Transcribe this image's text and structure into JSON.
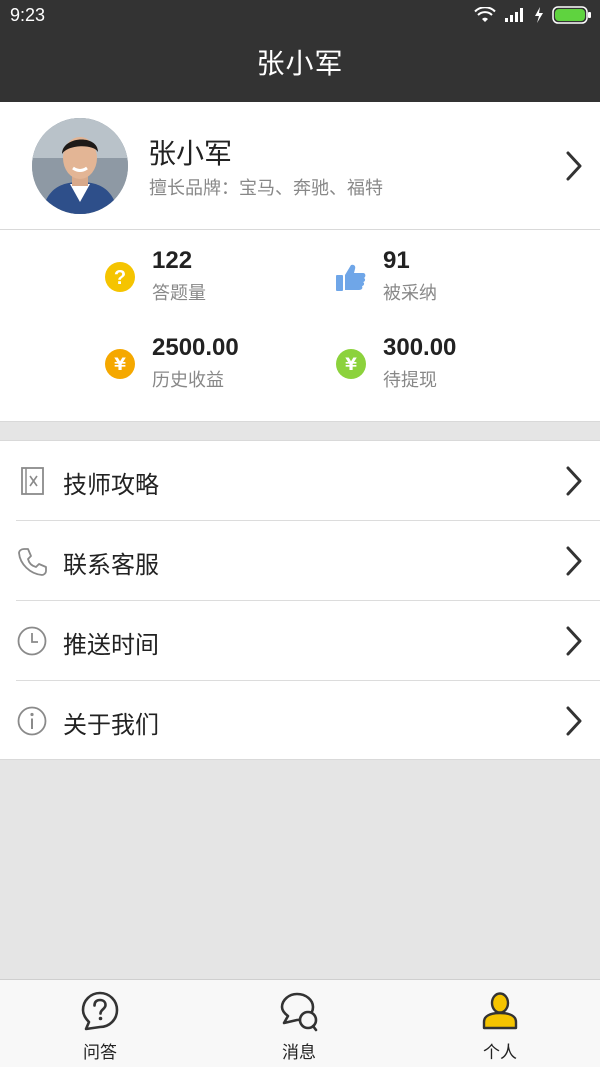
{
  "status_bar": {
    "time": "9:23"
  },
  "header": {
    "title": "张小军"
  },
  "profile": {
    "name": "张小军",
    "brands": "擅长品牌：宝马、奔驰、福特"
  },
  "stats": [
    {
      "value": "122",
      "label": "答题量",
      "icon": "question-icon",
      "color": "#f5c400"
    },
    {
      "value": "91",
      "label": "被采纳",
      "icon": "thumbs-up-icon",
      "color": "#6fa6e8"
    },
    {
      "value": "2500.00",
      "label": "历史收益",
      "icon": "yen-icon",
      "color": "#f5a800"
    },
    {
      "value": "300.00",
      "label": "待提现",
      "icon": "yen-icon",
      "color": "#8cd23c"
    }
  ],
  "menu": [
    {
      "label": "技师攻略",
      "icon": "guide-icon"
    },
    {
      "label": "联系客服",
      "icon": "phone-icon"
    },
    {
      "label": "推送时间",
      "icon": "clock-icon"
    },
    {
      "label": "关于我们",
      "icon": "info-icon"
    }
  ],
  "tabs": [
    {
      "label": "问答",
      "icon": "question-bubble-icon"
    },
    {
      "label": "消息",
      "icon": "chat-icon"
    },
    {
      "label": "个人",
      "icon": "person-icon",
      "active": true
    }
  ],
  "colors": {
    "header_bg": "#333333",
    "accent": "#f5c400",
    "battery": "#5fd33f"
  }
}
